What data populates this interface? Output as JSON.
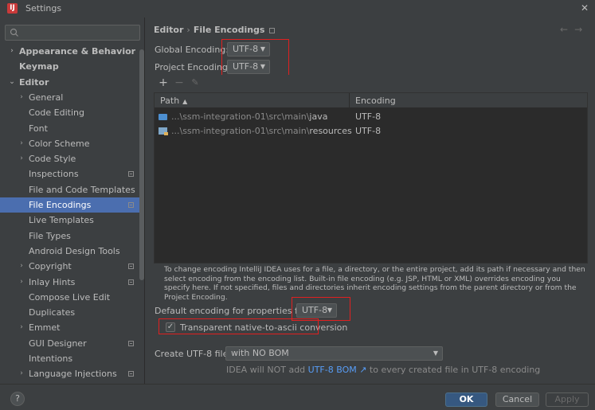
{
  "window": {
    "title": "Settings",
    "app_icon_glyph": "IJ",
    "close_glyph": "✕"
  },
  "search": {
    "placeholder": ""
  },
  "sidebar": {
    "items": [
      {
        "label": "Appearance & Behavior",
        "chevron": "›",
        "bold": true
      },
      {
        "label": "Keymap",
        "chevron": "",
        "bold": true
      },
      {
        "label": "Editor",
        "chevron": "⌄",
        "bold": true
      },
      {
        "label": "General",
        "chevron": "›",
        "bold": false
      },
      {
        "label": "Code Editing",
        "chevron": "",
        "bold": false
      },
      {
        "label": "Font",
        "chevron": "",
        "bold": false
      },
      {
        "label": "Color Scheme",
        "chevron": "›",
        "bold": false
      },
      {
        "label": "Code Style",
        "chevron": "›",
        "bold": false
      },
      {
        "label": "Inspections",
        "chevron": "",
        "bold": false,
        "project_icon": true
      },
      {
        "label": "File and Code Templates",
        "chevron": "",
        "bold": false
      },
      {
        "label": "File Encodings",
        "chevron": "",
        "bold": false,
        "project_icon": true,
        "selected": true
      },
      {
        "label": "Live Templates",
        "chevron": "",
        "bold": false
      },
      {
        "label": "File Types",
        "chevron": "",
        "bold": false
      },
      {
        "label": "Android Design Tools",
        "chevron": "",
        "bold": false
      },
      {
        "label": "Copyright",
        "chevron": "›",
        "bold": false,
        "project_icon": true
      },
      {
        "label": "Inlay Hints",
        "chevron": "›",
        "bold": false,
        "project_icon": true
      },
      {
        "label": "Compose Live Edit",
        "chevron": "",
        "bold": false
      },
      {
        "label": "Duplicates",
        "chevron": "",
        "bold": false
      },
      {
        "label": "Emmet",
        "chevron": "›",
        "bold": false
      },
      {
        "label": "GUI Designer",
        "chevron": "",
        "bold": false,
        "project_icon": true
      },
      {
        "label": "Intentions",
        "chevron": "",
        "bold": false
      },
      {
        "label": "Language Injections",
        "chevron": "›",
        "bold": false,
        "project_icon": true
      }
    ]
  },
  "breadcrumb": {
    "parent": "Editor",
    "separator": "›",
    "current": "File Encodings"
  },
  "nav": {
    "back": "←",
    "forward": "→"
  },
  "global_encoding": {
    "label": "Global Encoding:",
    "value": "UTF-8"
  },
  "project_encoding": {
    "label": "Project Encoding:",
    "value": "UTF-8"
  },
  "toolbar": {
    "add": "+",
    "remove": "−",
    "edit": "✎"
  },
  "table": {
    "headers": {
      "path": "Path",
      "path_sort": "▲",
      "encoding": "Encoding"
    },
    "rows": [
      {
        "path_prefix": "...\\ssm-integration-01\\src\\main\\",
        "path_leaf": "java",
        "encoding": "UTF-8",
        "icon": "folder-icon"
      },
      {
        "path_prefix": "...\\ssm-integration-01\\src\\main\\",
        "path_leaf": "resources",
        "encoding": "UTF-8",
        "icon": "resources-folder-icon"
      }
    ]
  },
  "info_text": "To change encoding IntelliJ IDEA uses for a file, a directory, or the entire project, add its path if necessary and then select encoding from the encoding list. Built-in file encoding (e.g. JSP, HTML or XML) overrides encoding you specify here. If not specified, files and directories inherit encoding settings from the parent directory or from the Project Encoding.",
  "properties_encoding": {
    "label": "Default encoding for properties files:",
    "value": "UTF-8"
  },
  "transparent_conversion": {
    "label": "Transparent native-to-ascii conversion",
    "checked": true
  },
  "bom": {
    "label": "Create UTF-8 files:",
    "value": "with NO BOM",
    "note_before": "IDEA will NOT add ",
    "note_link": "UTF-8 BOM ↗",
    "note_after": " to every created file in UTF-8 encoding"
  },
  "footer": {
    "help": "?",
    "ok": "OK",
    "cancel": "Cancel",
    "apply": "Apply"
  },
  "colors": {
    "background": "#3c3f41",
    "selection": "#4b6eaf",
    "primary_button": "#365880",
    "link": "#589df6",
    "highlight_box": "#e02020"
  }
}
